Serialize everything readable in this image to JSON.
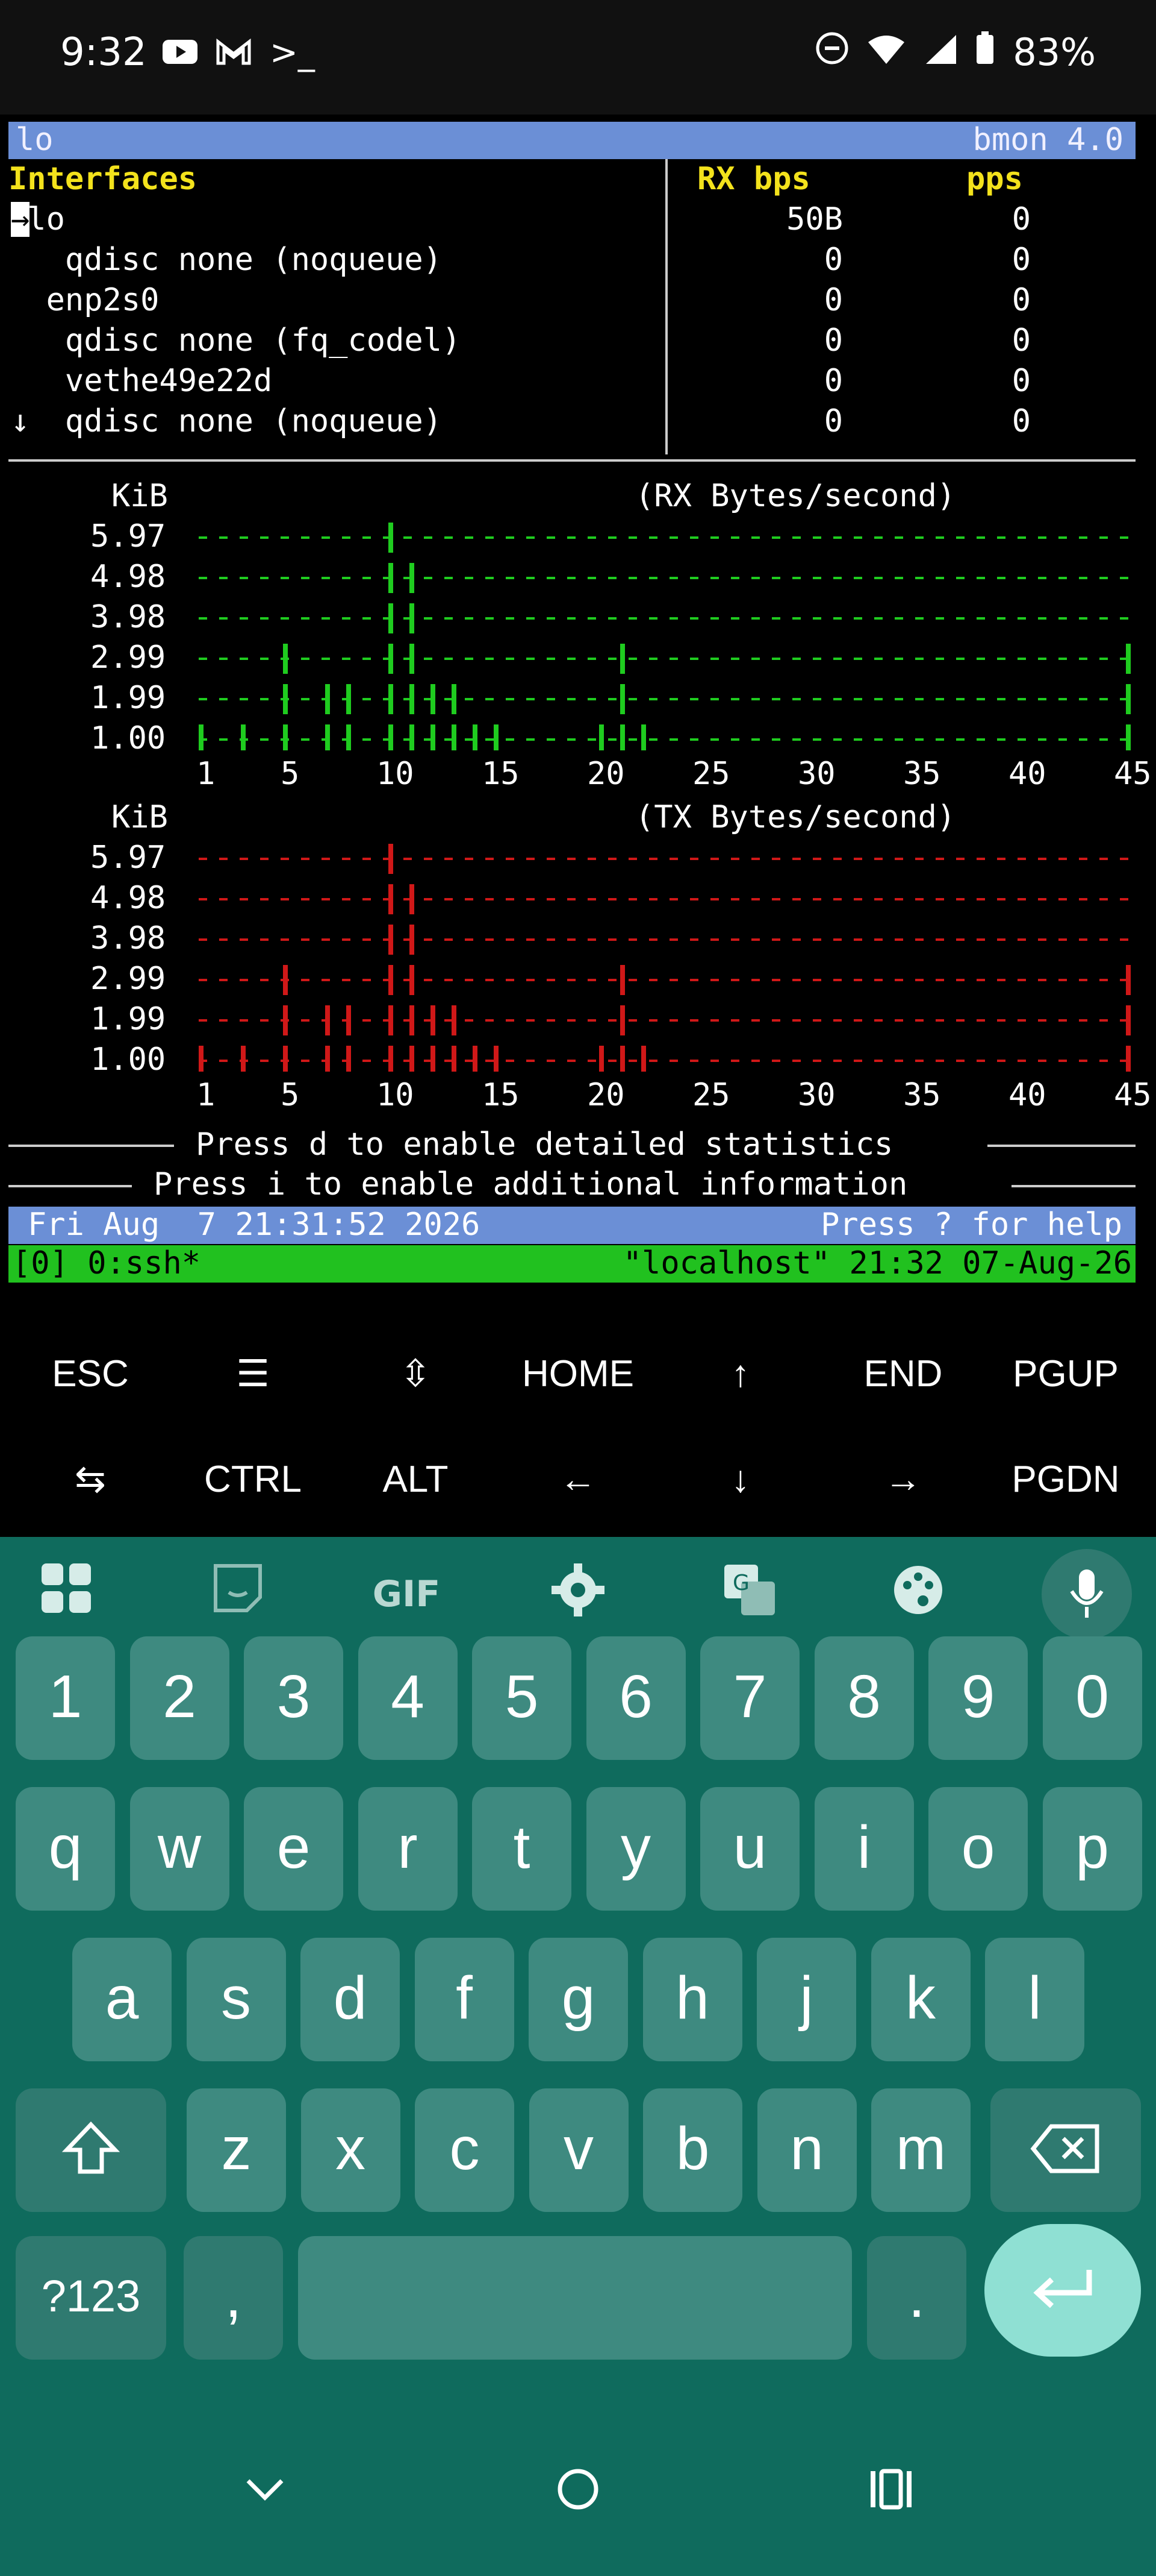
{
  "status_bar": {
    "time": "9:32",
    "battery": "83%",
    "icons": [
      "youtube-icon",
      "gmail-icon",
      "terminal-icon",
      "dnd-icon",
      "wifi-icon",
      "signal-icon",
      "battery-icon"
    ]
  },
  "terminal": {
    "title_left": "lo",
    "title_right": "bmon 4.0",
    "headers": {
      "interfaces": "Interfaces",
      "rx": "RX bps",
      "pps": "pps"
    },
    "rows": [
      {
        "marker": "→",
        "name": "lo",
        "rx": "50B",
        "pps": "0",
        "indent": 1
      },
      {
        "marker": "",
        "name": "qdisc none (noqueue)",
        "rx": "0",
        "pps": "0",
        "indent": 3
      },
      {
        "marker": "",
        "name": "enp2s0",
        "rx": "0",
        "pps": "0",
        "indent": 2
      },
      {
        "marker": "",
        "name": "qdisc none (fq_codel)",
        "rx": "0",
        "pps": "0",
        "indent": 3
      },
      {
        "marker": "",
        "name": "vethe49e22d",
        "rx": "0",
        "pps": "0",
        "indent": 3
      },
      {
        "marker": "↓",
        "name": "qdisc none (noqueue)",
        "rx": "0",
        "pps": "0",
        "indent": 3
      }
    ],
    "graph_rx": {
      "unit": "KiB",
      "title": "(RX Bytes/second)",
      "y_labels": [
        "5.97",
        "4.98",
        "3.98",
        "2.99",
        "1.99",
        "1.00"
      ],
      "x_labels": [
        "1",
        "5",
        "10",
        "15",
        "20",
        "25",
        "30",
        "35",
        "40",
        "45"
      ],
      "color": "#1fcc1f"
    },
    "graph_tx": {
      "unit": "KiB",
      "title": "(TX Bytes/second)",
      "y_labels": [
        "5.97",
        "4.98",
        "3.98",
        "2.99",
        "1.99",
        "1.00"
      ],
      "x_labels": [
        "1",
        "5",
        "10",
        "15",
        "20",
        "25",
        "30",
        "35",
        "40",
        "45"
      ],
      "color": "#d01818"
    },
    "hint_detailed": "Press d to enable detailed statistics",
    "hint_additional": "Press i to enable additional information",
    "datetime": "Fri Aug  7 21:31:52 2026",
    "help_hint": "Press ? for help",
    "tmux_left": "[0] 0:ssh*",
    "tmux_right": "\"localhost\" 21:32 07-Aug-26"
  },
  "extra_keys": {
    "row1": [
      "ESC",
      "☰",
      "⇳",
      "HOME",
      "↑",
      "END",
      "PGUP"
    ],
    "row2": [
      "⇆",
      "CTRL",
      "ALT",
      "←",
      "↓",
      "→",
      "PGDN"
    ]
  },
  "keyboard": {
    "toolbar": [
      "apps-icon",
      "sticker-icon",
      "GIF",
      "gear-icon",
      "translate-icon",
      "palette-icon",
      "mic-icon"
    ],
    "gif_label": "GIF",
    "numbers": [
      "1",
      "2",
      "3",
      "4",
      "5",
      "6",
      "7",
      "8",
      "9",
      "0"
    ],
    "row_q": [
      "q",
      "w",
      "e",
      "r",
      "t",
      "y",
      "u",
      "i",
      "o",
      "p"
    ],
    "row_a": [
      "a",
      "s",
      "d",
      "f",
      "g",
      "h",
      "j",
      "k",
      "l"
    ],
    "row_z": [
      "z",
      "x",
      "c",
      "v",
      "b",
      "n",
      "m"
    ],
    "sym_label": "?123",
    "comma": ",",
    "period": "."
  },
  "chart_data": [
    {
      "type": "bar",
      "title": "(RX Bytes/second)",
      "ylabel": "KiB",
      "x": [
        1,
        3,
        5,
        7,
        8,
        10,
        11,
        12,
        13,
        14,
        15,
        20,
        21,
        22,
        45
      ],
      "values": [
        1.0,
        1.0,
        2.99,
        1.99,
        1.99,
        5.97,
        4.98,
        1.99,
        1.99,
        1.0,
        1.0,
        1.0,
        2.99,
        1.0,
        2.99
      ],
      "ylim": [
        0,
        5.97
      ],
      "xlim": [
        1,
        45
      ]
    },
    {
      "type": "bar",
      "title": "(TX Bytes/second)",
      "ylabel": "KiB",
      "x": [
        1,
        3,
        5,
        7,
        8,
        10,
        11,
        12,
        13,
        14,
        15,
        20,
        21,
        22,
        45
      ],
      "values": [
        1.0,
        1.0,
        2.99,
        1.99,
        1.99,
        5.97,
        4.98,
        1.99,
        1.99,
        1.0,
        1.0,
        1.0,
        2.99,
        1.0,
        2.99
      ],
      "ylim": [
        0,
        5.97
      ],
      "xlim": [
        1,
        45
      ]
    }
  ]
}
